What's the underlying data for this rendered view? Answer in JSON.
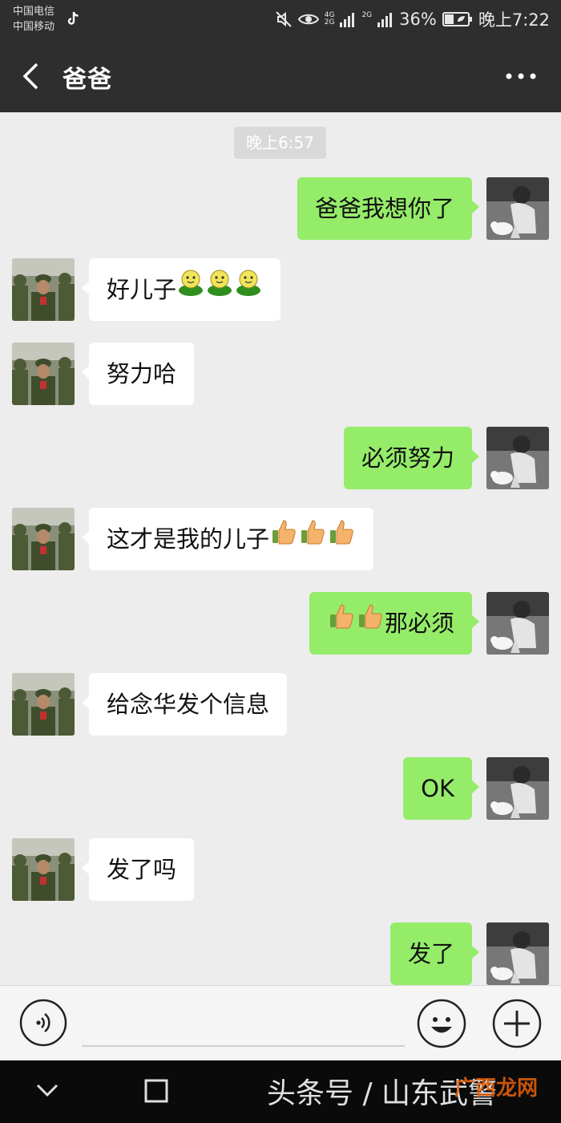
{
  "status_bar": {
    "carrier_1": "中国电信",
    "carrier_2": "中国移动",
    "network_1": "4G",
    "network_2": "2G",
    "network_3": "2G",
    "battery": "36%",
    "time": "晚上7:22"
  },
  "header": {
    "back_icon": "chevron-left-icon",
    "title": "爸爸",
    "more_icon": "more-dots-icon"
  },
  "chat": {
    "timestamp": "晚上6:57",
    "messages": [
      {
        "side": "right",
        "text": "爸爸我想你了",
        "emoji": "",
        "emoji_count": 0
      },
      {
        "side": "left",
        "text": "好儿子",
        "emoji": "green-smiley-emoji",
        "emoji_count": 3
      },
      {
        "side": "left",
        "text": "努力哈",
        "emoji": "",
        "emoji_count": 0
      },
      {
        "side": "right",
        "text": "必须努力",
        "emoji": "",
        "emoji_count": 0
      },
      {
        "side": "left",
        "text": "这才是我的儿子",
        "emoji": "thumbs-up-emoji",
        "emoji_count": 3
      },
      {
        "side": "right",
        "text": "那必须",
        "emoji": "thumbs-up-emoji",
        "emoji_count": 2,
        "emoji_first": true
      },
      {
        "side": "left",
        "text": "给念华发个信息",
        "emoji": "",
        "emoji_count": 0
      },
      {
        "side": "right",
        "text": "OK",
        "emoji": "",
        "emoji_count": 0
      },
      {
        "side": "left",
        "text": "发了吗",
        "emoji": "",
        "emoji_count": 0
      },
      {
        "side": "right",
        "text": "发了",
        "emoji": "",
        "emoji_count": 0
      }
    ]
  },
  "input_bar": {
    "voice_icon": "voice-icon",
    "emoji_icon": "emoji-icon",
    "plus_icon": "plus-icon"
  },
  "nav_bar": {
    "back_icon": "chevron-down-icon",
    "home_icon": "square-icon",
    "watermark": "头条号 / 山东武警",
    "watermark_badge": "广西龙网"
  },
  "colors": {
    "header_bg": "#2e2e2e",
    "chat_bg": "#ededed",
    "sent_bubble": "#95ec69",
    "received_bubble": "#ffffff"
  }
}
